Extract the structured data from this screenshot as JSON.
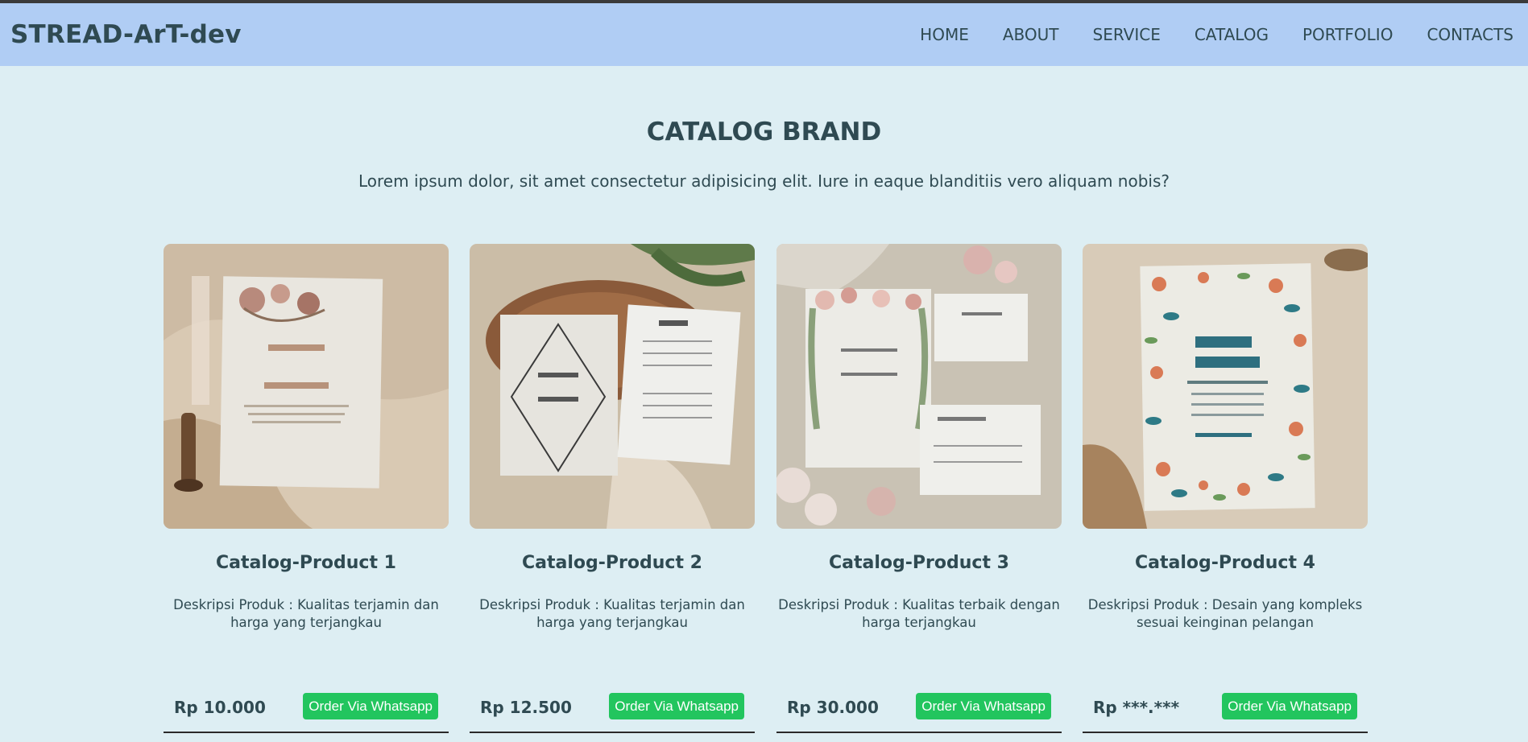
{
  "header": {
    "brand": "STREAD-ArT-dev",
    "nav": [
      "HOME",
      "ABOUT",
      "SERVICE",
      "CATALOG",
      "PORTFOLIO",
      "CONTACTS"
    ]
  },
  "catalog": {
    "title": "CATALOG BRAND",
    "subtitle": "Lorem ipsum dolor, sit amet consectetur adipisicing elit. Iure in eaque blanditiis vero aliquam nobis?",
    "products": [
      {
        "name": "Catalog-Product 1",
        "desc": "Deskripsi Produk : Kualitas terjamin dan harga yang terjangkau",
        "price": "Rp 10.000",
        "button": "Order Via Whatsapp"
      },
      {
        "name": "Catalog-Product 2",
        "desc": "Deskripsi Produk : Kualitas terjamin dan harga yang terjangkau",
        "price": "Rp 12.500",
        "button": "Order Via Whatsapp"
      },
      {
        "name": "Catalog-Product 3",
        "desc": "Deskripsi Produk : Kualitas terbaik dengan harga terjangkau",
        "price": "Rp 30.000",
        "button": "Order Via Whatsapp"
      },
      {
        "name": "Catalog-Product 4",
        "desc": "Deskripsi Produk : Desain yang kompleks sesuai keinginan pelangan",
        "price": "Rp ***.***",
        "button": "Order Via Whatsapp"
      }
    ]
  },
  "colors": {
    "navbar": "#b0cdf4",
    "background": "#ddeef3",
    "text": "#2f4a52",
    "whatsapp_button": "#22c55e"
  }
}
